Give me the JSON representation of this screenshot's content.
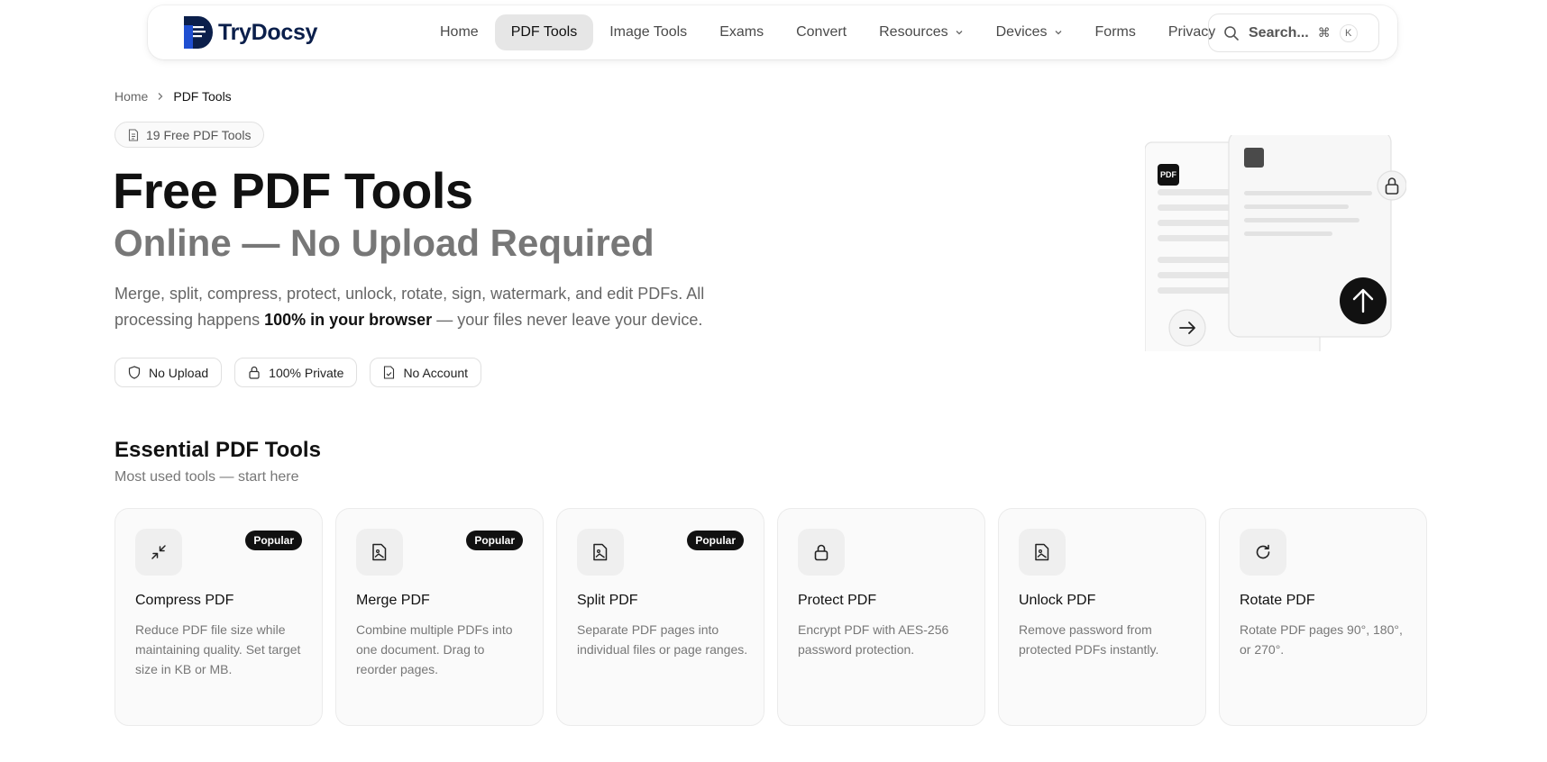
{
  "brand": {
    "name": "TryDocsy"
  },
  "nav": {
    "links": [
      {
        "label": "Home"
      },
      {
        "label": "PDF Tools"
      },
      {
        "label": "Image Tools"
      },
      {
        "label": "Exams"
      },
      {
        "label": "Convert"
      },
      {
        "label": "Resources"
      },
      {
        "label": "Devices"
      },
      {
        "label": "Forms"
      },
      {
        "label": "Privacy"
      }
    ],
    "active": "PDF Tools",
    "search_label": "Search...",
    "kbd_cmd": "⌘",
    "kbd_key": "K"
  },
  "breadcrumb": {
    "home": "Home",
    "current": "PDF Tools"
  },
  "hero": {
    "badge": "19 Free PDF Tools",
    "title": "Free PDF Tools",
    "subtitle": "Online — No Upload Required",
    "desc_1": "Merge, split, compress, protect, unlock, rotate, sign, watermark, and edit PDFs. All processing happens ",
    "desc_bold": "100% in your browser",
    "desc_2": " — your files never leave your device.",
    "pills": [
      "No Upload",
      "100% Private",
      "No Account"
    ],
    "illustration_label": "PDF"
  },
  "section": {
    "title": "Essential PDF Tools",
    "subtitle": "Most used tools — start here"
  },
  "cards": [
    {
      "title": "Compress PDF",
      "desc": "Reduce PDF file size while maintaining quality. Set target size in KB or MB.",
      "badge": "Popular",
      "icon": "compress-icon"
    },
    {
      "title": "Merge PDF",
      "desc": "Combine multiple PDFs into one document. Drag to reorder pages.",
      "badge": "Popular",
      "icon": "file-image-icon"
    },
    {
      "title": "Split PDF",
      "desc": "Separate PDF pages into individual files or page ranges.",
      "badge": "Popular",
      "icon": "file-image-icon"
    },
    {
      "title": "Protect PDF",
      "desc": "Encrypt PDF with AES-256 password protection.",
      "badge": "",
      "icon": "lock-icon"
    },
    {
      "title": "Unlock PDF",
      "desc": "Remove password from protected PDFs instantly.",
      "badge": "",
      "icon": "file-image-icon"
    },
    {
      "title": "Rotate PDF",
      "desc": "Rotate PDF pages 90°, 180°, or 270°.",
      "badge": "",
      "icon": "rotate-icon"
    }
  ],
  "colors": {
    "accent": "#111111",
    "brand_blue": "#1f4fd1",
    "brand_navy": "#0b1f4b"
  }
}
